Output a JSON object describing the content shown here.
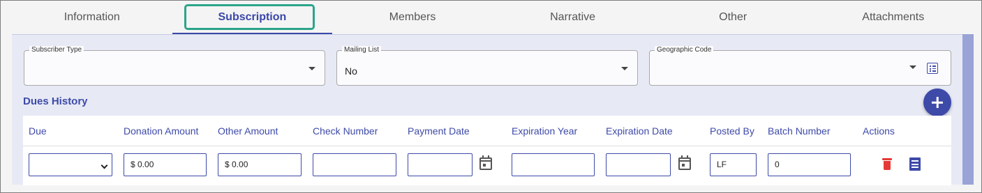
{
  "tabs": [
    {
      "label": "Information",
      "active": false
    },
    {
      "label": "Subscription",
      "active": true
    },
    {
      "label": "Members",
      "active": false
    },
    {
      "label": "Narrative",
      "active": false
    },
    {
      "label": "Other",
      "active": false
    },
    {
      "label": "Attachments",
      "active": false
    }
  ],
  "fields": {
    "subscriber_type": {
      "label": "Subscriber Type",
      "value": ""
    },
    "mailing_list": {
      "label": "Mailing List",
      "value": "No"
    },
    "geographic_code": {
      "label": "Geographic Code",
      "value": ""
    }
  },
  "dues_history": {
    "title": "Dues History",
    "columns": [
      "Due",
      "Donation Amount",
      "Other Amount",
      "Check Number",
      "Payment Date",
      "Expiration Year",
      "Expiration Date",
      "Posted By",
      "Batch Number",
      "Actions"
    ],
    "row": {
      "due": "",
      "donation_amount": "$ 0.00",
      "other_amount": "$ 0.00",
      "check_number": "",
      "payment_date": "",
      "expiration_year": "",
      "expiration_date": "",
      "posted_by": "LF",
      "batch_number": "0"
    }
  },
  "icons": {
    "add": "add-icon",
    "calendar": "calendar-icon",
    "delete": "trash-icon",
    "receipt": "receipt-icon",
    "list": "list-icon"
  },
  "colors": {
    "accent": "#3d4aa8",
    "focus": "#2ba489",
    "delete": "#e53935",
    "panel": "#e7eaf5"
  }
}
